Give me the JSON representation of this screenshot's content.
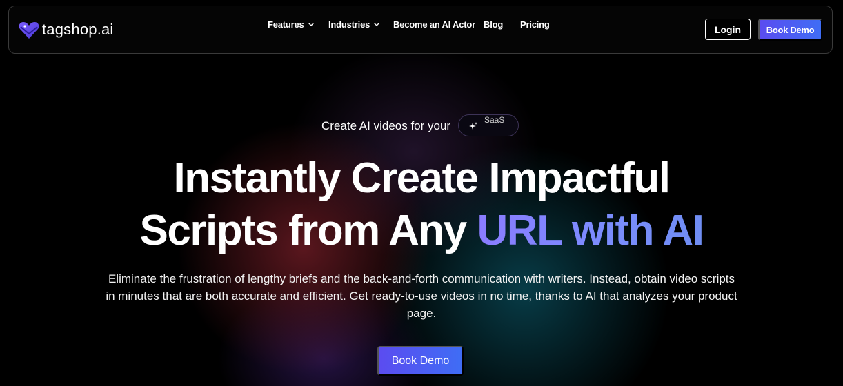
{
  "brand": {
    "name": "tagshop.ai",
    "icon": "heart-tag-icon",
    "color": "#6a4cf5"
  },
  "nav": {
    "items": [
      {
        "label": "Features",
        "has_dropdown": true
      },
      {
        "label": "Industries",
        "has_dropdown": true
      },
      {
        "label": "Become an AI Actor",
        "has_dropdown": false
      },
      {
        "label": "Blog",
        "has_dropdown": false
      },
      {
        "label": "Pricing",
        "has_dropdown": false
      }
    ],
    "login_label": "Login",
    "book_demo_label": "Book Demo"
  },
  "hero": {
    "tagline": "Create AI videos for your",
    "rotating_word": "SaaS",
    "headline_line1": "Instantly Create Impactful",
    "headline_line2_plain": "Scripts from Any ",
    "headline_line2_accent": "URL with AI",
    "subtext": "Eliminate the frustration of lengthy briefs and the back-and-forth communication with writers. Instead, obtain video scripts in minutes that are both accurate and efficient. Get ready-to-use videos in no time, thanks to AI that analyzes your product page.",
    "cta_label": "Book Demo"
  },
  "colors": {
    "accent_gradient_start": "#5b4cf0",
    "accent_gradient_end": "#3f6df5",
    "headline_accent": "#8a7cff"
  }
}
